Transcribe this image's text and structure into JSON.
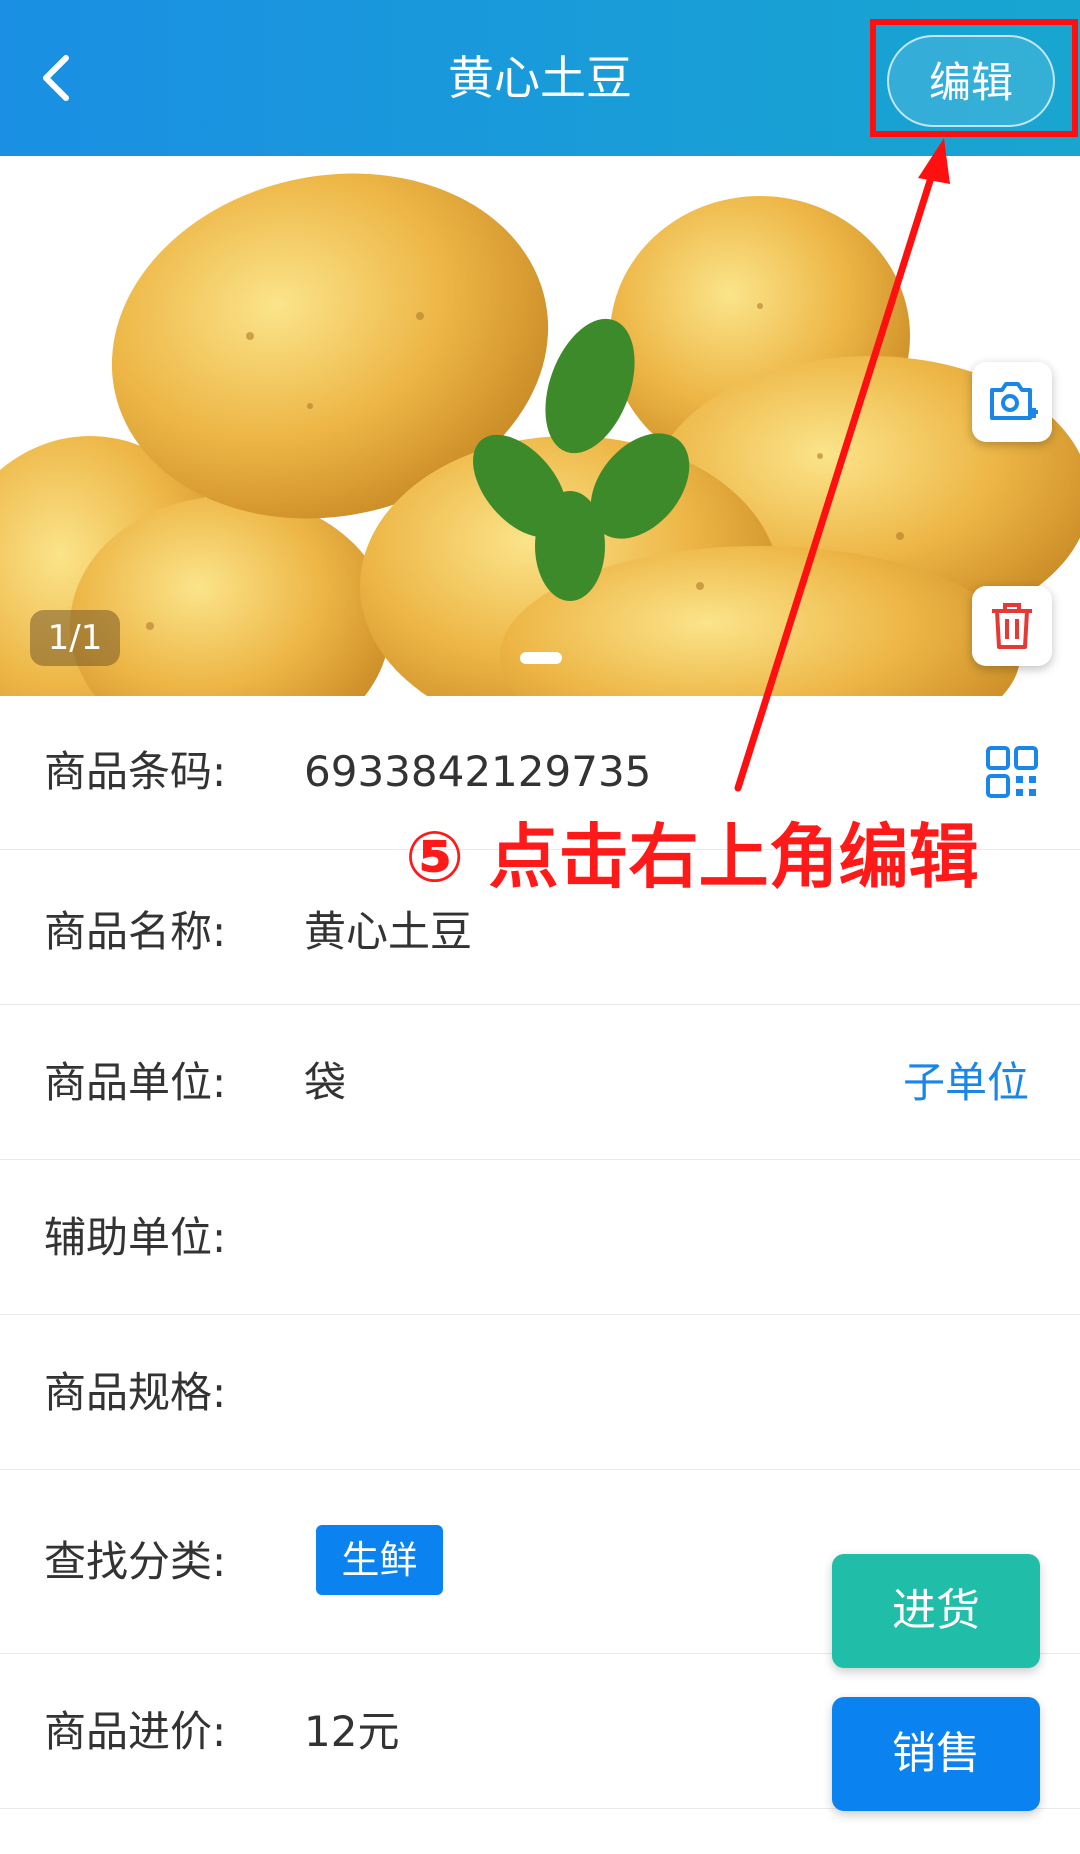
{
  "header": {
    "title": "黄心土豆",
    "edit_label": "编辑"
  },
  "gallery": {
    "counter": "1/1",
    "add_photo_icon": "camera-plus-icon",
    "delete_icon": "trash-icon"
  },
  "fields": [
    {
      "label": "商品条码:",
      "value": "6933842129735",
      "action_icon": "qr-code-icon"
    },
    {
      "label": "商品名称:",
      "value": "黄心土豆"
    },
    {
      "label": "商品单位:",
      "value": "袋",
      "action_label": "子单位"
    },
    {
      "label": "辅助单位:",
      "value": ""
    },
    {
      "label": "商品规格:",
      "value": ""
    },
    {
      "label": "查找分类:",
      "tag": "生鲜"
    },
    {
      "label": "商品进价:",
      "value": "12元"
    }
  ],
  "actions": {
    "purchase": "进货",
    "sell": "销售"
  },
  "annotation": {
    "text": "⑤ 点击右上角编辑"
  },
  "colors": {
    "header_start": "#1a8fe3",
    "header_end": "#18a6d0",
    "purchase_btn": "#20bda9",
    "sell_btn": "#0a82f0",
    "tag_bg": "#0a82f0",
    "link": "#1a86e8",
    "annotation": "#ff1a1a"
  }
}
